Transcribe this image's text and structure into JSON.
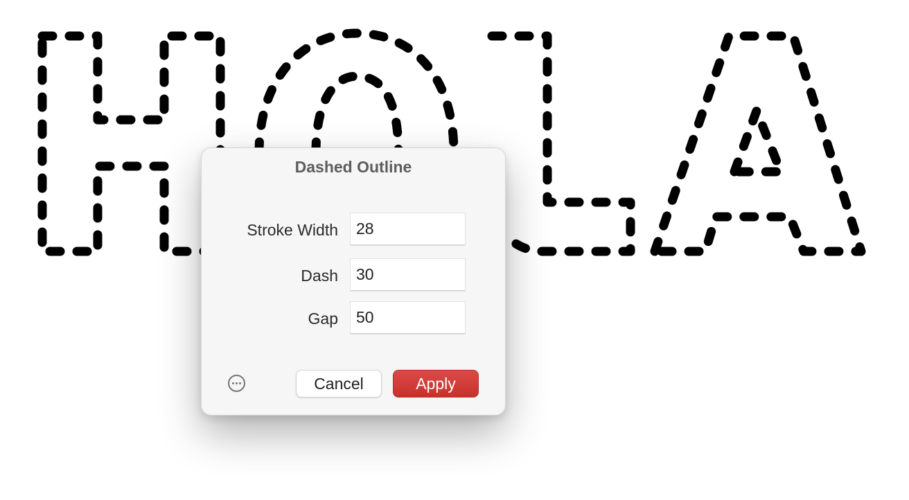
{
  "canvas": {
    "text": "HOLA",
    "stroke_color": "#000000",
    "background": "#ffffff"
  },
  "dialog": {
    "title": "Dashed Outline",
    "fields": [
      {
        "label": "Stroke Width",
        "value": "28"
      },
      {
        "label": "Dash",
        "value": "30"
      },
      {
        "label": "Gap",
        "value": "50"
      }
    ],
    "more_icon": "ellipsis-circle-icon",
    "cancel_label": "Cancel",
    "apply_label": "Apply",
    "apply_color": "#d0383a"
  }
}
